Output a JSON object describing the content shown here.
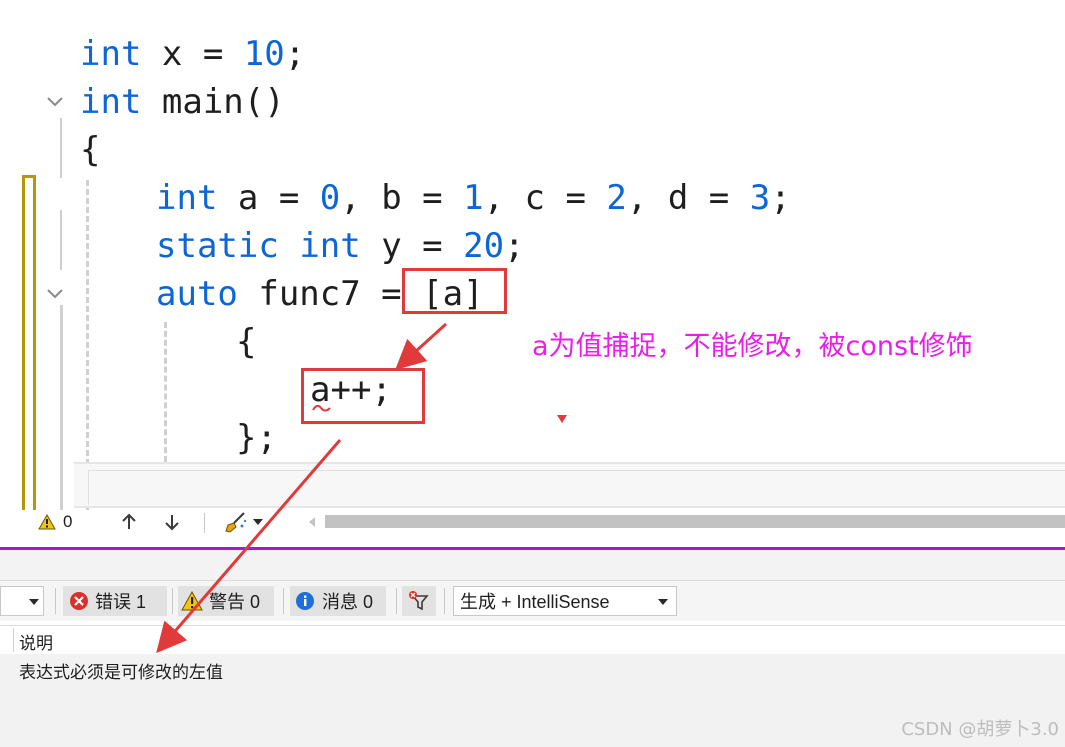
{
  "code": {
    "line1": {
      "kw": "int",
      "rest1": " x = ",
      "num": "10",
      "rest2": ";"
    },
    "line2": {
      "kw": "int",
      "rest1": " main()"
    },
    "line3": {
      "text": "{"
    },
    "line4": {
      "kw": "int",
      "a": " a = ",
      "n0": "0",
      "b": ", b = ",
      "n1": "1",
      "c": ", c = ",
      "n2": "2",
      "d": ", d = ",
      "n3": "3",
      "end": ";"
    },
    "line5": {
      "kw1": "static",
      "sp": " ",
      "kw2": "int",
      "rest1": " y = ",
      "num": "20",
      "rest2": ";"
    },
    "line6": {
      "kw": "auto",
      "rest1": " func7 = ",
      "capture": "[a]"
    },
    "line7": {
      "text": "{"
    },
    "line8": {
      "text": "a++;"
    },
    "line9": {
      "text": "};"
    }
  },
  "annotation": "a为值捕捉，不能修改，被const修饰",
  "editor_status": {
    "warning_count": "0"
  },
  "error_toolbar": {
    "errors_label": "错误 1",
    "warnings_label": "警告 0",
    "messages_label": "消息 0",
    "source_filter": "生成 + IntelliSense"
  },
  "error_list": {
    "column_description": "说明",
    "rows": [
      {
        "description": "表达式必须是可修改的左值"
      }
    ]
  },
  "watermark": "CSDN @胡萝卜3.0",
  "colors": {
    "keyword": "#0b66d6",
    "annotation": "#e91ee9",
    "highlight_box": "#e03a3a",
    "separator": "#a21ad9"
  },
  "icons": [
    "fold-chevron-icon",
    "warning-icon",
    "arrow-up-icon",
    "arrow-down-icon",
    "brush-icon",
    "error-icon",
    "info-icon",
    "filter-icon",
    "dropdown-arrow-icon"
  ]
}
